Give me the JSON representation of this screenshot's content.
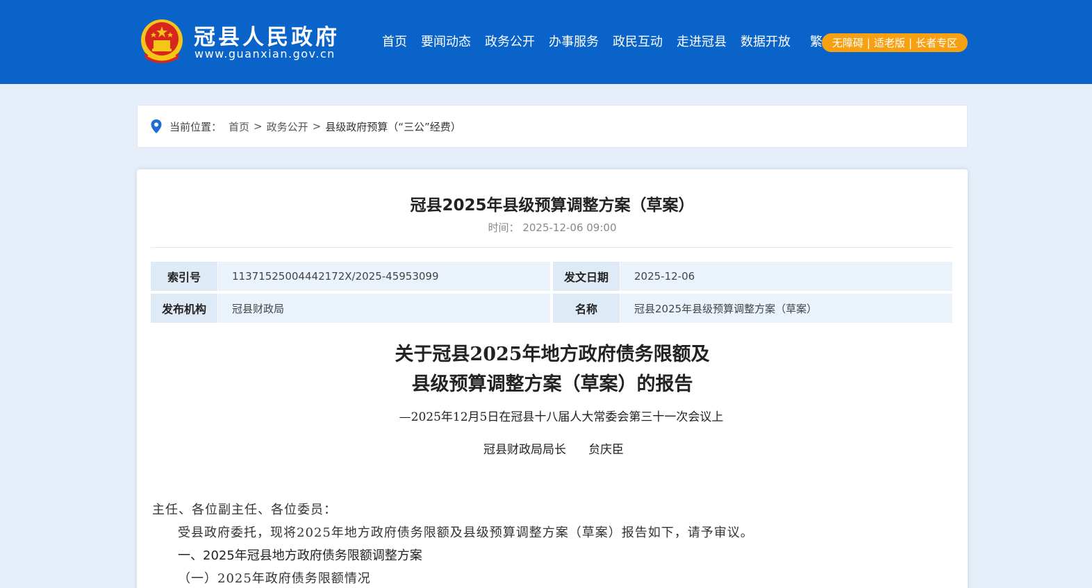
{
  "header": {
    "site_title": "冠县人民政府",
    "site_url": "www.guanxian.gov.cn",
    "nav": [
      "首页",
      "要闻动态",
      "政务公开",
      "办事服务",
      "政民互动",
      "走进冠县",
      "数据开放"
    ],
    "traditional_label": "繁",
    "accessibility": [
      "无障碍",
      "适老版",
      "长者专区"
    ],
    "accessibility_sep": "|",
    "colors": {
      "bar": "#0a63c9",
      "pill": "#f7a012"
    }
  },
  "breadcrumb": {
    "label": "当前位置：",
    "items": [
      "首页",
      "政务公开",
      "县级政府预算（“三公”经费）"
    ],
    "sep": ">"
  },
  "article": {
    "title": "冠县2025年县级预算调整方案（草案）",
    "time_label": "时间：",
    "time_value": "2025-12-06 09:00",
    "meta": {
      "index_label": "索引号",
      "index_value": "11371525004442172X/2025-45953099",
      "date_label": "发文日期",
      "date_value": "2025-12-06",
      "org_label": "发布机构",
      "org_value": "冠县财政局",
      "name_label": "名称",
      "name_value": "冠县2025年县级预算调整方案（草案）"
    }
  },
  "report": {
    "title_line1": "关于冠县2025年地方政府债务限额及",
    "title_line2": "县级预算调整方案（草案）的报告",
    "subtitle": "—2025年12月5日在冠县十八届人大常委会第三十一次会议上",
    "author_title": "冠县财政局局长",
    "author_name": "贠庆臣",
    "greeting": "主任、各位副主任、各位委员：",
    "intro": "受县政府委托，现将2025年地方政府债务限额及县级预算调整方案（草案）报告如下，请予审议。",
    "section1": "一、2025年冠县地方政府债务限额调整方案",
    "section1_1": "（一）2025年政府债务限额情况"
  }
}
